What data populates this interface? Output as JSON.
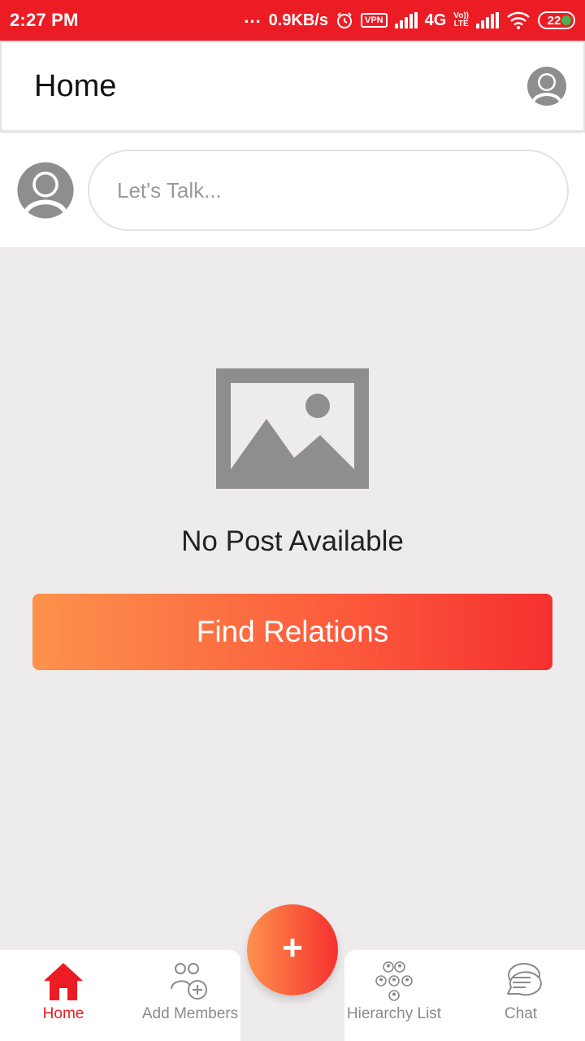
{
  "status_bar": {
    "time": "2:27 PM",
    "dots": "...",
    "speed": "0.9KB/s",
    "vpn": "VPN",
    "network": "4G",
    "volte_top": "Vo))",
    "volte_bottom": "LTE",
    "battery": "22",
    "icons": [
      "alarm-icon",
      "vpn-icon",
      "signal-icon",
      "signal-icon",
      "wifi-icon",
      "battery-icon"
    ]
  },
  "header": {
    "title": "Home",
    "profile_icon": "avatar-icon"
  },
  "composer": {
    "avatar_icon": "avatar-icon",
    "placeholder": "Let's Talk..."
  },
  "empty_state": {
    "icon": "image-placeholder-icon",
    "message": "No Post Available",
    "button_label": "Find Relations"
  },
  "colors": {
    "primary": "#ec1c24",
    "gradient_start": "#fd924c",
    "gradient_end": "#f5302f",
    "background": "#edebec",
    "icon_gray": "#8e8e8e"
  },
  "fab": {
    "label": "+"
  },
  "bottom_nav": {
    "items": [
      {
        "label": "Home",
        "icon": "home-icon",
        "active": true
      },
      {
        "label": "Add Members",
        "icon": "add-members-icon",
        "active": false
      },
      {
        "label": "Hierarchy List",
        "icon": "hierarchy-icon",
        "active": false
      },
      {
        "label": "Chat",
        "icon": "chat-icon",
        "active": false
      }
    ]
  }
}
